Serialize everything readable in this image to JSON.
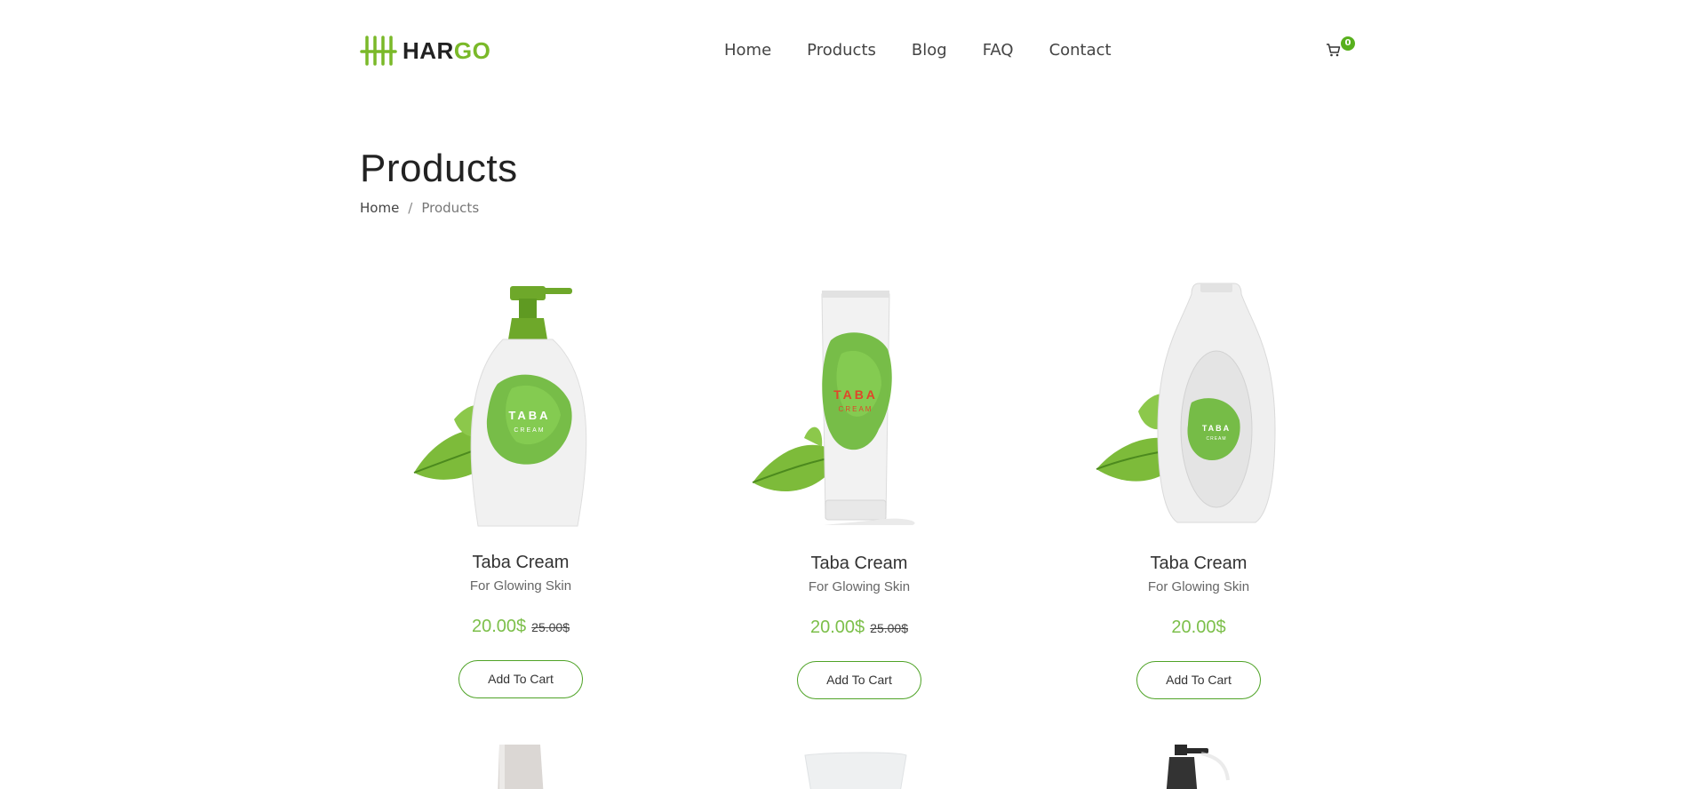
{
  "brand": {
    "part1": "HAR",
    "part2": "GO",
    "accent": "#7ab929"
  },
  "nav": [
    "Home",
    "Products",
    "Blog",
    "FAQ",
    "Contact"
  ],
  "cart": {
    "icon": "cart-icon",
    "count": "0",
    "badge_color": "#58b01d"
  },
  "page": {
    "title": "Products"
  },
  "breadcrumb": {
    "home": "Home",
    "separator": "/",
    "current": "Products"
  },
  "products": [
    {
      "name": "Taba Cream",
      "subtitle": "For Glowing Skin",
      "price": "20.00$",
      "old_price": "25.00$",
      "button": "Add To Cart",
      "image": "pump-bottle"
    },
    {
      "name": "Taba Cream",
      "subtitle": "For Glowing Skin",
      "price": "20.00$",
      "old_price": "25.00$",
      "button": "Add To Cart",
      "image": "tube"
    },
    {
      "name": "Taba Cream",
      "subtitle": "For Glowing Skin",
      "price": "20.00$",
      "old_price": "",
      "button": "Add To Cart",
      "image": "bottle"
    }
  ],
  "product_label": {
    "line1": "TABA",
    "line2": "CREAM"
  }
}
